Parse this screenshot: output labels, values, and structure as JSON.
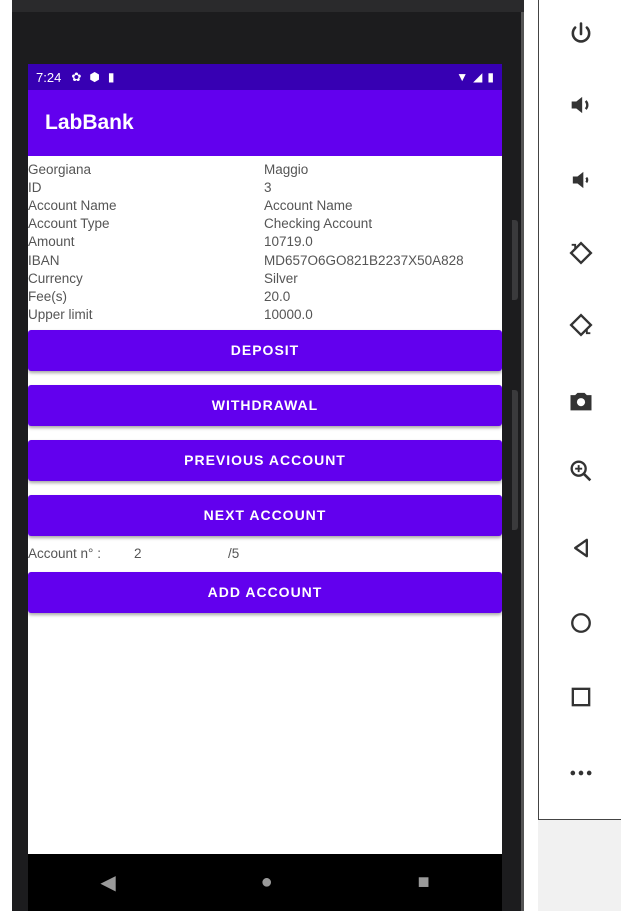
{
  "status_bar": {
    "time": "7:24"
  },
  "app": {
    "title": "LabBank"
  },
  "account": {
    "rows": [
      {
        "label": "Georgiana",
        "value": "Maggio"
      },
      {
        "label": "ID",
        "value": "3"
      },
      {
        "label": "Account Name",
        "value": "Account Name"
      },
      {
        "label": "Account Type",
        "value": "Checking Account"
      },
      {
        "label": "Amount",
        "value": "10719.0"
      },
      {
        "label": "IBAN",
        "value": "MD657O6GO821B2237X50A828"
      },
      {
        "label": "Currency",
        "value": "Silver"
      },
      {
        "label": "Fee(s)",
        "value": "20.0"
      },
      {
        "label": "Upper limit",
        "value": "10000.0"
      }
    ]
  },
  "buttons": {
    "deposit": "DEPOSIT",
    "withdrawal": "WITHDRAWAL",
    "previous": "PREVIOUS ACCOUNT",
    "next": "NEXT ACCOUNT",
    "add": "ADD ACCOUNT"
  },
  "pager": {
    "label": "Account n° :",
    "current": "2",
    "total": "/5"
  },
  "colors": {
    "primary": "#6200ee",
    "primary_dark": "#3700b3"
  },
  "toolbar_icons": [
    "power-icon",
    "volume-up-icon",
    "volume-down-icon",
    "rotate-left-icon",
    "rotate-right-icon",
    "camera-icon",
    "zoom-in-icon",
    "back-icon",
    "home-icon",
    "overview-icon",
    "more-icon"
  ]
}
